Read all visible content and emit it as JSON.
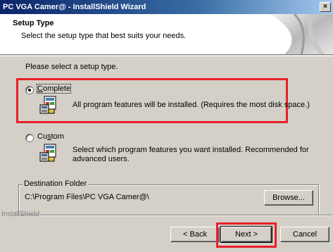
{
  "window": {
    "title": "PC VGA Camer@ - InstallShield Wizard",
    "close_glyph": "×"
  },
  "header": {
    "title": "Setup Type",
    "subtitle": "Select the setup type that best suits your needs."
  },
  "prompt": "Please select a setup type.",
  "options": [
    {
      "label": "Complete",
      "access_key": "C",
      "checked": true,
      "description": "All program features will be installed. (Requires the most disk space.)",
      "icon": "setup-package-icon"
    },
    {
      "label": "Custom",
      "access_key": "s",
      "checked": false,
      "description_line1": "Select which program features you want installed. Recommended for",
      "description_line2": "advanced users.",
      "icon": "setup-package-icon"
    }
  ],
  "destination": {
    "legend": "Destination Folder",
    "path": "C:\\Program Files\\PC VGA Camer@\\",
    "browse_label": "Browse..."
  },
  "footer": {
    "brand": "InstallShield",
    "back_label": "< Back",
    "next_label": "Next >",
    "cancel_label": "Cancel"
  },
  "colors": {
    "highlight": "#e8202a",
    "titlebar_start": "#0a246a",
    "titlebar_end": "#a6caf0",
    "dialog_bg": "#d4d0c8"
  }
}
